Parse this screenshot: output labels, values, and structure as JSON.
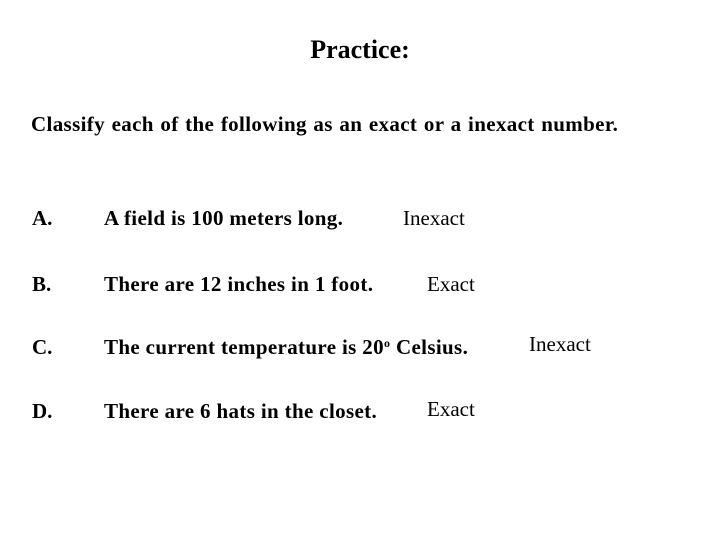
{
  "title": "Practice:",
  "instruction": "Classify each of the following as an exact or a inexact number.",
  "items": [
    {
      "letter": "A.",
      "text": "A field is 100 meters long.",
      "answer": "Inexact"
    },
    {
      "letter": "B.",
      "text": "There are 12 inches in 1 foot.",
      "answer": "Exact"
    },
    {
      "letter": "C.",
      "text_before": "The current temperature is 20",
      "text_sup": "o",
      "text_after": " Celsius.",
      "answer": "Inexact"
    },
    {
      "letter": "D.",
      "text": "There are 6 hats in the closet.",
      "answer": "Exact"
    }
  ]
}
